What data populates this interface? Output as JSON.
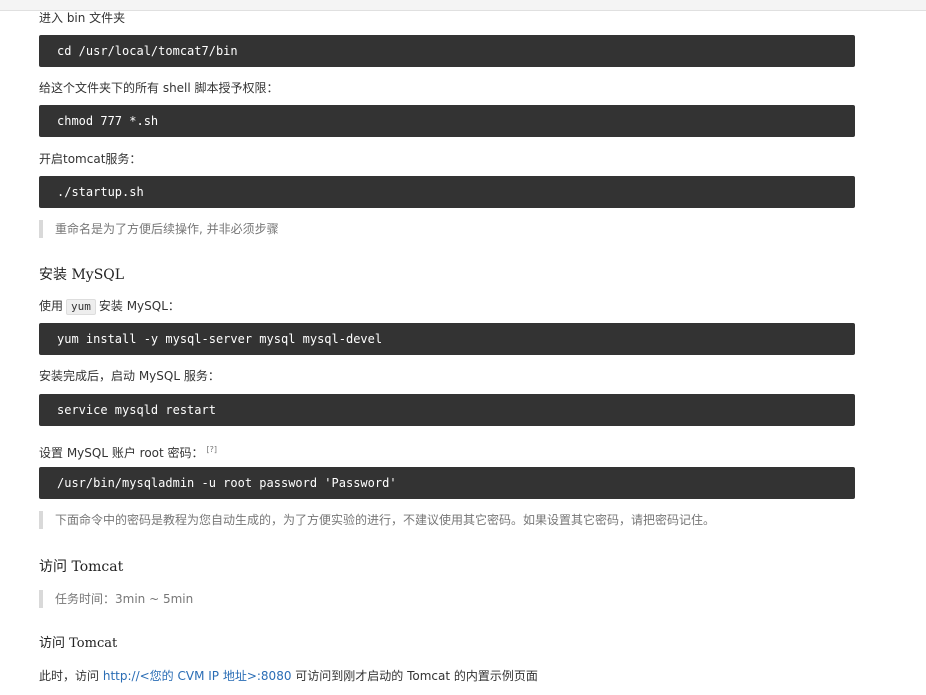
{
  "steps": {
    "enter_bin": "进入 bin 文件夹",
    "cmd_cd": "cd /usr/local/tomcat7/bin",
    "chmod_desc": "给这个文件夹下的所有 shell 脚本授予权限：",
    "cmd_chmod": "chmod 777 *.sh",
    "start_tomcat": "开启tomcat服务：",
    "cmd_startup": "./startup.sh",
    "note_rename": "重命名是为了方便后续操作, 并非必须步骤"
  },
  "mysql": {
    "heading": "安装 MySQL",
    "use_prefix": "使用",
    "use_code": "yum",
    "use_suffix": "安装 MySQL：",
    "cmd_install": "yum install -y mysql-server mysql mysql-devel",
    "after_install": "安装完成后，启动 MySQL 服务：",
    "cmd_restart": "service mysqld restart",
    "set_password": "设置 MySQL 账户 root 密码：",
    "ref_mark": "[?]",
    "cmd_password": "/usr/bin/mysqladmin -u root password 'Password'",
    "note_password": "下面命令中的密码是教程为您自动生成的，为了方便实验的进行，不建议使用其它密码。如果设置其它密码，请把密码记住。"
  },
  "tomcat": {
    "heading": "访问 Tomcat",
    "task_time": "任务时间：3min ~ 5min",
    "sub_heading": "访问 Tomcat",
    "visit_prefix": "此时，访问",
    "visit_link": "http://<您的 CVM IP 地址>:8080",
    "visit_suffix": "可访问到刚才启动的 Tomcat 的内置示例页面"
  }
}
